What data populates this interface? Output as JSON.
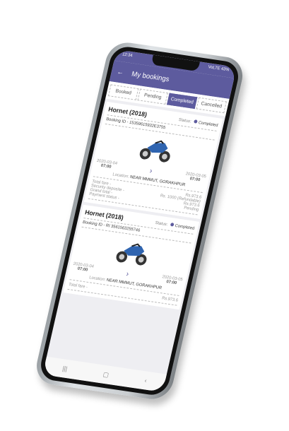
{
  "status_bar": {
    "time": "12:34",
    "right": "VoLTE 43%"
  },
  "header": {
    "title": "My bookings",
    "back_icon": "arrow-left-icon"
  },
  "tabs": [
    {
      "label": "Booked"
    },
    {
      "label": "Pending"
    },
    {
      "label": "Completed",
      "active": true
    },
    {
      "label": "Cancelled"
    }
  ],
  "bookings": [
    {
      "title": "Hornet (2018)",
      "status_label": "Status:",
      "status": "Completed",
      "booking_id": "Booking ID - 15359615932E3755",
      "start_date": "2020-03-04",
      "start_time": "07:00",
      "end_date": "2020-03-05",
      "end_time": "07:00",
      "location_label": "Location:",
      "location": "NEAR MMMUT, GORAKHPUR",
      "fee_labels": [
        "Total fare -",
        "Security deposite -",
        "Grand total -",
        "Payment status -"
      ],
      "fee_values": [
        "Rs.973.6",
        "Rs. 1000 (Refundable)",
        "Rs.973.6",
        "Pending"
      ]
    },
    {
      "title": "Hornet (2018)",
      "status_label": "Status:",
      "status": "Completed",
      "booking_id": "Booking ID - RI 3561563255746",
      "start_date": "2020-03-04",
      "start_time": "07:00",
      "end_date": "2020-03-05",
      "end_time": "07:00",
      "location_label": "Location:",
      "location": "NEAR MMMUT, GORAKHPUR",
      "fee_labels": [
        "Total fare -"
      ],
      "fee_values": [
        "Rs.973.6"
      ]
    }
  ],
  "nav": {
    "recent": "|||",
    "home": "▢",
    "back": "‹"
  },
  "colors": {
    "primary": "#5d5b9e"
  }
}
